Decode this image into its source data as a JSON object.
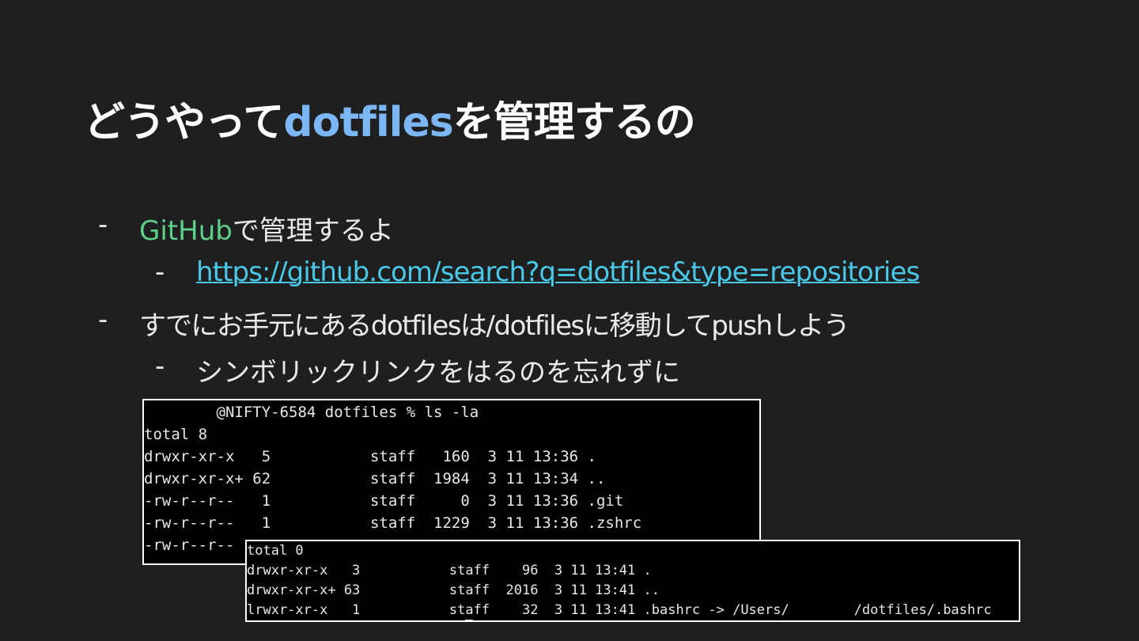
{
  "title": {
    "prefix": "どうやって",
    "highlight": "dotfiles",
    "suffix": "を管理するの"
  },
  "bullets": [
    {
      "dash": "-",
      "green": "GitHub",
      "text": "で管理するよ"
    },
    {
      "dash": "-",
      "link": "https://github.com/search?q=dotfiles&type=repositories"
    },
    {
      "dash": "-",
      "text": "すでにお手元にあるdotfilesは/dotfilesに移動してpushしよう"
    },
    {
      "dash": "-",
      "text": "シンボリックリンクをはるのを忘れずに"
    }
  ],
  "terminal1": {
    "lines": [
      "        @NIFTY-6584 dotfiles % ls -la",
      "total 8",
      "drwxr-xr-x   5           staff   160  3 11 13:36 .",
      "drwxr-xr-x+ 62           staff  1984  3 11 13:34 ..",
      "-rw-r--r--   1           staff     0  3 11 13:36 .git",
      "-rw-r--r--   1           staff  1229  3 11 13:36 .zshrc",
      "-rw-r--r--"
    ]
  },
  "terminal2": {
    "lines": [
      "total 0",
      "drwxr-xr-x   3           staff    96  3 11 13:41 .",
      "drwxr-xr-x+ 63           staff  2016  3 11 13:41 ..",
      "lrwxr-xr-x   1           staff    32  3 11 13:41 .bashrc -> /Users/        /dotfiles/.bashrc"
    ]
  }
}
